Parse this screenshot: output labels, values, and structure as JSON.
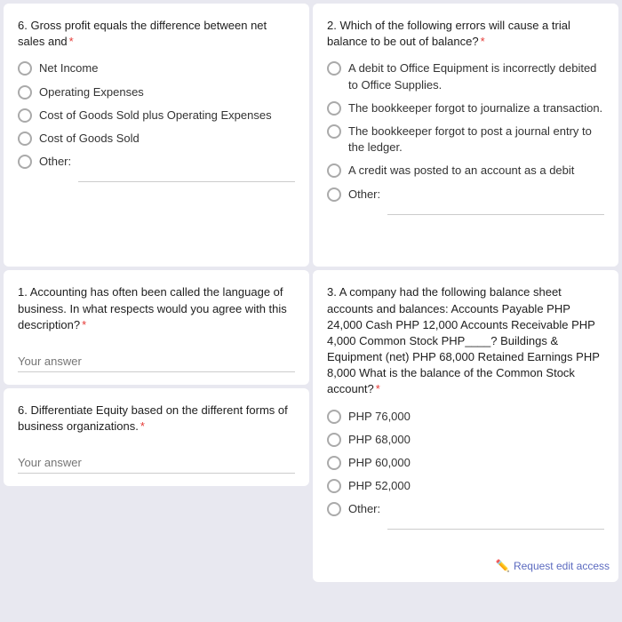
{
  "q6_gross": {
    "question": "6. Gross profit equals the difference between net sales and",
    "required": true,
    "options": [
      "Net Income",
      "Operating Expenses",
      "Cost of Goods Sold plus Operating Expenses",
      "Cost of Goods Sold",
      "Other:"
    ]
  },
  "q2_trial": {
    "question": "2. Which of the following errors will cause a trial balance to be out of balance?",
    "required": true,
    "options": [
      "A debit to Office Equipment is incorrectly debited to Office Supplies.",
      "The bookkeeper forgot to journalize a transaction.",
      "The bookkeeper forgot to post a journal entry to the ledger.",
      "A credit was posted to an account as a debit",
      "Other:"
    ]
  },
  "q1_accounting": {
    "question": "1. Accounting has often been called the language of business. In what respects would you agree with this description?",
    "required": true,
    "placeholder": "Your answer"
  },
  "q6_equity": {
    "question": "6. Differentiate Equity based on the different forms of business organizations.",
    "required": true,
    "placeholder": "Your answer"
  },
  "q3_balance": {
    "question": "3. A company had the following balance sheet accounts and balances: Accounts Payable PHP 24,000 Cash PHP 12,000 Accounts Receivable PHP 4,000 Common Stock PHP____? Buildings & Equipment (net) PHP 68,000 Retained Earnings PHP 8,000 What is the balance of the Common Stock account?",
    "required": true,
    "options": [
      "PHP 76,000",
      "PHP 68,000",
      "PHP 60,000",
      "PHP 52,000",
      "Other:"
    ]
  },
  "ui": {
    "request_edit_label": "Request edit access"
  }
}
